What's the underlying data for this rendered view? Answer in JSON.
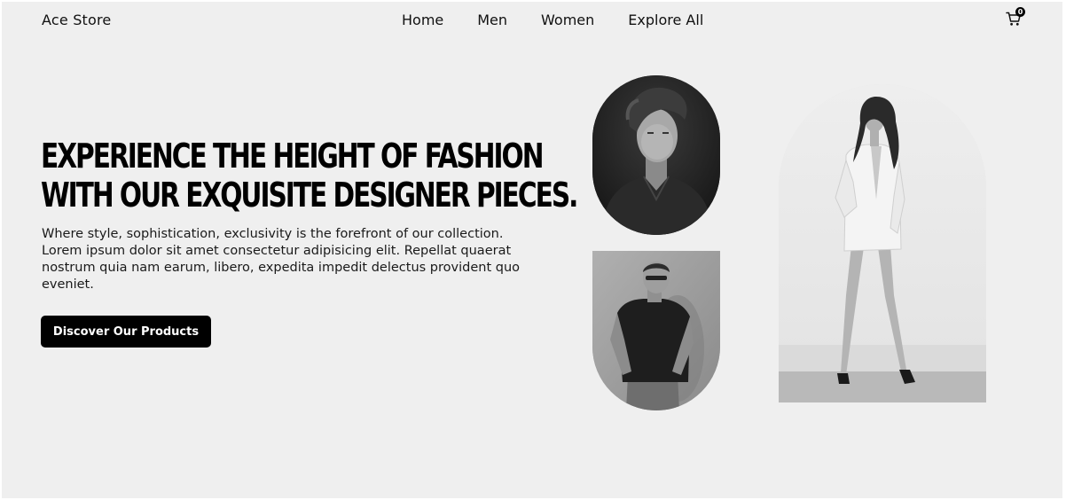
{
  "header": {
    "brand": "Ace Store",
    "nav": [
      "Home",
      "Men",
      "Women",
      "Explore All"
    ],
    "cart_count": "0",
    "cart_icon": "shopping-cart-icon"
  },
  "hero": {
    "headline_line1": "Experience the height of fashion",
    "headline_line2": "with our exquisite designer pieces.",
    "description": "Where style, sophistication, exclusivity is the forefront of our collection. Lorem ipsum dolor sit amet consectetur adipisicing elit. Repellat quaerat nostrum quia nam earum, libero, expedita impedit delectus provident quo eveniet.",
    "cta_label": "Discover Our Products"
  },
  "gallery": {
    "images": [
      "man-portrait",
      "man-casual",
      "woman-standing"
    ]
  }
}
